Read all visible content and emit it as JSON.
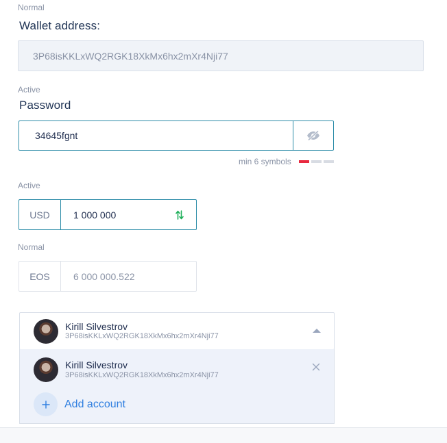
{
  "wallet": {
    "state": "Normal",
    "title": "Wallet address:",
    "value": "3P68isKKLxWQ2RGK18XkMx6hx2mXr4Nji77"
  },
  "password": {
    "state": "Active",
    "title": "Password",
    "value": "34645fgnt",
    "toggle_icon": "eye-off-icon",
    "hint": "min 6 symbols",
    "strength_level": 1,
    "strength_max": 3,
    "strength_color": "#e8293f"
  },
  "usd_field": {
    "state": "Active",
    "currency": "USD",
    "amount": "1 000 000",
    "swap_icon": "swap-vertical-icon",
    "accent": "#2a8ba7"
  },
  "eos_field": {
    "state": "Normal",
    "currency": "EOS",
    "amount": "6 000 000.522"
  },
  "account_select": {
    "selected": {
      "name": "Kirill Silvestrov",
      "address": "3P68isKKLxWQ2RGK18XkMx6hx2mXr4Nji77"
    },
    "chevron_icon": "chevron-up-icon",
    "dropdown": {
      "items": [
        {
          "name": "Kirill Silvestrov",
          "address": "3P68isKKLxWQ2RGK18XkMx6hx2mXr4Nji77"
        }
      ],
      "add_label": "Add account",
      "add_icon": "plus-icon",
      "link_color": "#2f7fe0"
    }
  }
}
